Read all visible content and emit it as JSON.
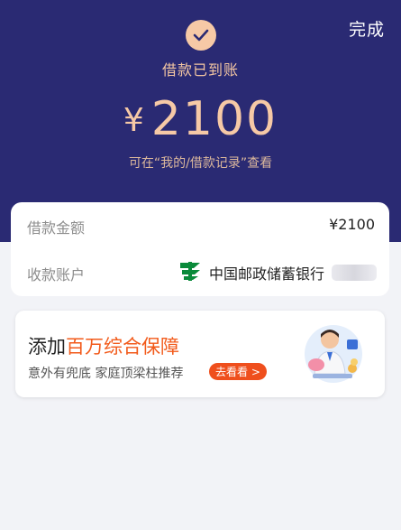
{
  "header": {
    "done_label": "完成",
    "status_text": "借款已到账",
    "currency_symbol": "¥",
    "amount": "2100",
    "hint": "可在“我的/借款记录”查看"
  },
  "details": {
    "rows": [
      {
        "label": "借款金额",
        "value": "¥2100"
      },
      {
        "label": "收款账户",
        "value": "中国邮政储蓄银行"
      }
    ]
  },
  "promo": {
    "title_prefix": "添加",
    "title_highlight": "百万综合保障",
    "subtitle": "意外有兜底 家庭顶梁柱推荐",
    "cta": "去看看 >"
  },
  "colors": {
    "hero_bg": "#2a2a73",
    "accent_gold": "#f6c9a6",
    "promo_orange": "#f25a1a",
    "bank_green": "#0a8a3a"
  },
  "icons": [
    "check-icon",
    "postal-bank-logo-icon",
    "insurance-illustration-icon"
  ]
}
